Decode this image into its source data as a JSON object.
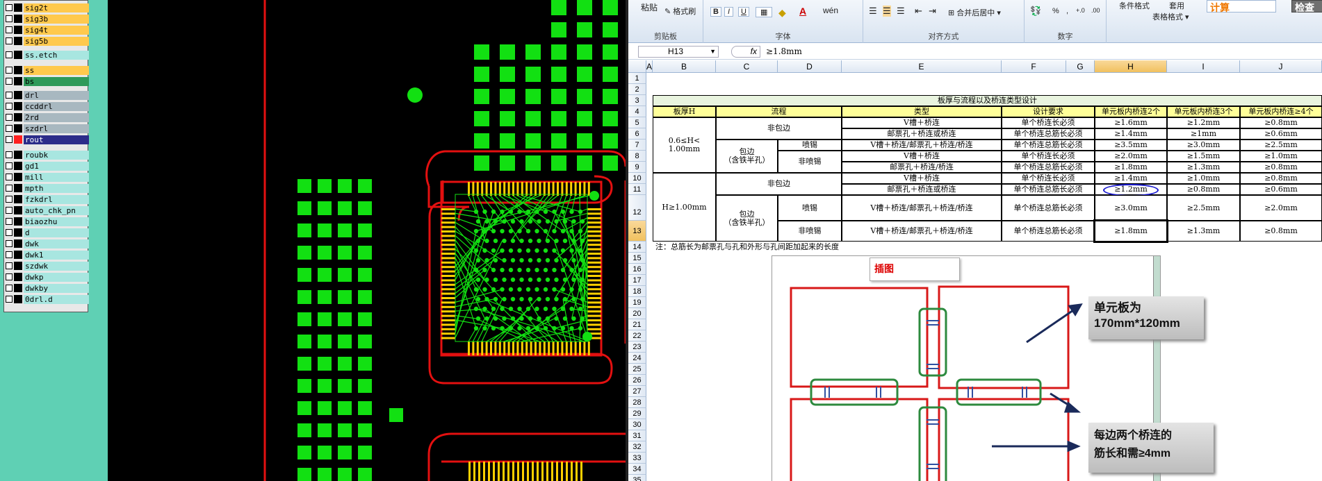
{
  "cad_layers": [
    {
      "name": "sig2t",
      "color": "#ffc94d",
      "swatch": "#000000"
    },
    {
      "name": "sig3b",
      "color": "#ffc94d",
      "swatch": "#000000"
    },
    {
      "name": "sig4t",
      "color": "#ffc94d",
      "swatch": "#000000"
    },
    {
      "name": "sig5b",
      "color": "#ffc94d",
      "swatch": "#000000"
    },
    {
      "name": "ss.etch",
      "color": "#a8e6e0",
      "swatch": "#000000"
    },
    {
      "name": "ss",
      "color": "#ffc94d",
      "swatch": "#000000"
    },
    {
      "name": "bs",
      "color": "#2f9a5a",
      "swatch": "#000000"
    },
    {
      "name": "drl",
      "color": "#a8b8c0",
      "swatch": "#000000"
    },
    {
      "name": "ccddrl",
      "color": "#a8b8c0",
      "swatch": "#000000"
    },
    {
      "name": "2rd",
      "color": "#a8b8c0",
      "swatch": "#000000"
    },
    {
      "name": "szdrl",
      "color": "#a8b8c0",
      "swatch": "#000000"
    },
    {
      "name": "rout",
      "color": "#2c2c8a",
      "swatch": "#ff2020"
    },
    {
      "name": "roubk",
      "color": "#a8e6e0",
      "swatch": "#000000"
    },
    {
      "name": "gd1",
      "color": "#a8e6e0",
      "swatch": "#000000"
    },
    {
      "name": "mill",
      "color": "#a8e6e0",
      "swatch": "#000000"
    },
    {
      "name": "mpth",
      "color": "#a8e6e0",
      "swatch": "#000000"
    },
    {
      "name": "fzkdrl",
      "color": "#a8e6e0",
      "swatch": "#000000"
    },
    {
      "name": "auto_chk_pn",
      "color": "#a8e6e0",
      "swatch": "#000000"
    },
    {
      "name": "biaozhu",
      "color": "#a8e6e0",
      "swatch": "#000000"
    },
    {
      "name": "d",
      "color": "#a8e6e0",
      "swatch": "#000000"
    },
    {
      "name": "dwk",
      "color": "#a8e6e0",
      "swatch": "#000000"
    },
    {
      "name": "dwk1",
      "color": "#a8e6e0",
      "swatch": "#000000"
    },
    {
      "name": "szdwk",
      "color": "#a8e6e0",
      "swatch": "#000000"
    },
    {
      "name": "dwkp",
      "color": "#a8e6e0",
      "swatch": "#000000"
    },
    {
      "name": "dwkby",
      "color": "#a8e6e0",
      "swatch": "#000000"
    },
    {
      "name": "0drl.d",
      "color": "#a8e6e0",
      "swatch": "#000000"
    }
  ],
  "ribbon": {
    "paste": "粘贴",
    "format_painter": "格式刷",
    "clipboard": "剪贴板",
    "font": "字体",
    "alignment": "对齐方式",
    "merge_center": "合并后居中",
    "number": "数字",
    "percent": "%",
    "conditional_format": "条件格式",
    "apply": "套用",
    "table_format": "表格格式",
    "calc": "计算",
    "check": "检查"
  },
  "formula_bar": {
    "name_box": "H13",
    "fx": "fx",
    "value": "≥1.8mm"
  },
  "columns": [
    "A",
    "B",
    "C",
    "D",
    "E",
    "F",
    "G",
    "H",
    "I",
    "J"
  ],
  "rows": [
    "1",
    "2",
    "3",
    "4",
    "5",
    "6",
    "7",
    "8",
    "9",
    "10",
    "11",
    "12",
    "13",
    "14",
    "15",
    "16",
    "17",
    "18",
    "19",
    "20",
    "21",
    "22",
    "23",
    "24",
    "25",
    "26",
    "27",
    "28",
    "29",
    "30",
    "31",
    "32",
    "33",
    "34",
    "35"
  ],
  "table": {
    "title": "板厚与流程以及桥连类型设计",
    "headers": {
      "thickness": "板厚H",
      "process": "流程",
      "type": "类型",
      "req": "设计要求",
      "h2": "单元板内桥连2个",
      "h3": "单元板内桥连3个",
      "h4": "单元板内桥连≥4个"
    },
    "g1_thickness": "0.6≤H<\n1.00mm",
    "g2_thickness": "H≥1.00mm",
    "non_wrap": "非包边",
    "wrap": "包边\n（含铁半孔）",
    "spray": "喷锡",
    "non_spray": "非喷锡",
    "rows": [
      {
        "type": "V槽＋桥连",
        "req": "单个桥连长必须",
        "v2": "≥1.6mm",
        "v3": "≥1.2mm",
        "v4": "≥0.8mm"
      },
      {
        "type": "邮票孔＋桥连或桥连",
        "req": "单个桥连总筋长必须",
        "v2": "≥1.4mm",
        "v3": "≥1mm",
        "v4": "≥0.6mm"
      },
      {
        "type": "V槽＋桥连/邮票孔＋桥连/桥连",
        "req": "单个桥连总筋长必须",
        "v2": "≥3.5mm",
        "v3": "≥3.0mm",
        "v4": "≥2.5mm"
      },
      {
        "type": "V槽＋桥连",
        "req": "单个桥连长必须",
        "v2": "≥2.0mm",
        "v3": "≥1.5mm",
        "v4": "≥1.0mm"
      },
      {
        "type": "邮票孔＋桥连/桥连",
        "req": "单个桥连总筋长必须",
        "v2": "≥1.8mm",
        "v3": "≥1.3mm",
        "v4": "≥0.8mm"
      },
      {
        "type": "V槽＋桥连",
        "req": "单个桥连长必须",
        "v2": "≥1.4mm",
        "v3": "≥1.0mm",
        "v4": "≥0.8mm"
      },
      {
        "type": "邮票孔＋桥连或桥连",
        "req": "单个桥连总筋长必须",
        "v2": "≥1.2mm",
        "v3": "≥0.8mm",
        "v4": "≥0.6mm"
      },
      {
        "type": "V槽＋桥连/邮票孔＋桥连/桥连",
        "req": "单个桥连总筋长必须",
        "v2": "≥3.0mm",
        "v3": "≥2.5mm",
        "v4": "≥2.0mm"
      },
      {
        "type": "V槽＋桥连/邮票孔＋桥连/桥连",
        "req": "单个桥连总筋长必须",
        "v2": "≥1.8mm",
        "v3": "≥1.3mm",
        "v4": "≥0.8mm"
      }
    ],
    "note": "注：总筋长为邮票孔与孔和外形与孔间距加起来的长度"
  },
  "illustration": {
    "title": "插图",
    "callout1": "单元板为\n170mm*120mm",
    "callout2": "每边两个桥连的\n筋长和需≥4mm"
  }
}
